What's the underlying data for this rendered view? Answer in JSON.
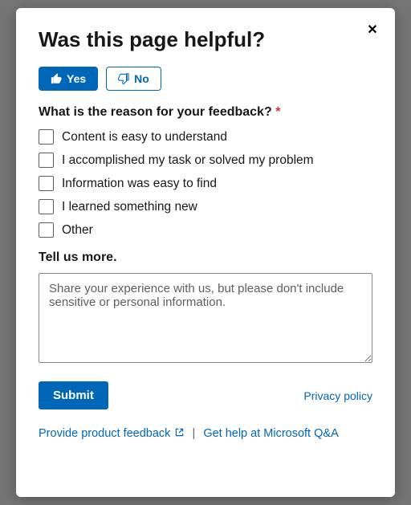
{
  "modal": {
    "title": "Was this page helpful?",
    "close_label": "✕",
    "yes_label": "Yes",
    "no_label": "No",
    "question": "What is the reason for your feedback?",
    "required_mark": "*",
    "options": [
      "Content is easy to understand",
      "I accomplished my task or solved my problem",
      "Information was easy to find",
      "I learned something new",
      "Other"
    ],
    "tell_us_label": "Tell us more.",
    "textarea_placeholder": "Share your experience with us, but please don't include sensitive or personal information.",
    "submit_label": "Submit",
    "privacy_label": "Privacy policy",
    "product_feedback_label": "Provide product feedback",
    "qa_label": "Get help at Microsoft Q&A",
    "separator": "|"
  }
}
